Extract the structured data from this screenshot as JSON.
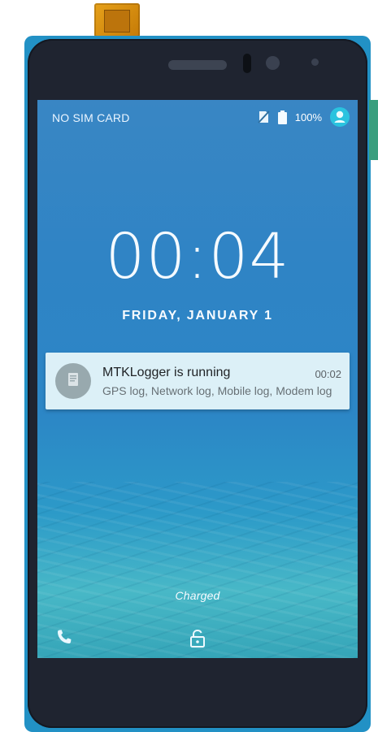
{
  "device": {
    "speaker_icon": "speaker-icon",
    "front_camera_icon": "camera-icon",
    "proximity_sensor_icon": "sensor-icon"
  },
  "status_bar": {
    "carrier_text": "NO SIM CARD",
    "battery_text": "100%",
    "icons": [
      "no-sim-icon",
      "battery-icon",
      "user-icon"
    ]
  },
  "lockscreen": {
    "time": "00:04",
    "date": "FRIDAY, JANUARY 1",
    "charge_status": "Charged",
    "bottom_actions": {
      "left_icon": "phone-icon",
      "center_icon": "unlock-icon"
    }
  },
  "notification": {
    "app_icon": "document-icon",
    "title": "MTKLogger is running",
    "time": "00:02",
    "body": "GPS log, Network log, Mobile log, Modem log"
  },
  "colors": {
    "frame_blue": "#2291c5",
    "phone_body": "#1f2430",
    "avatar_cyan": "#2ac3df",
    "notification_bg": "#e8f6fa"
  }
}
